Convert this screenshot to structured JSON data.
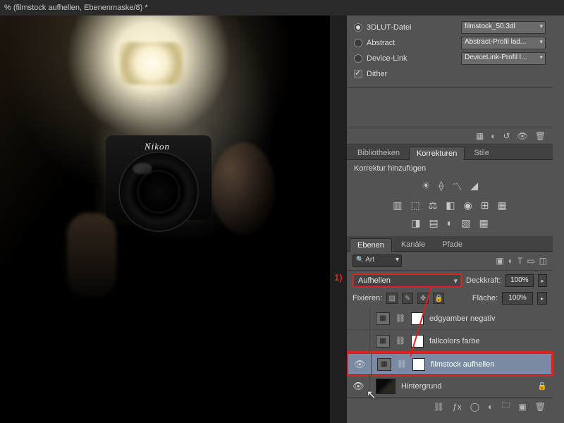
{
  "document": {
    "tab_title": "% (filmstock aufhellen, Ebenenmaske/8) *"
  },
  "camera_brand": "Nikon",
  "properties": {
    "lut_file": {
      "label": "3DLUT-Datei",
      "value": "filmstock_50.3dl"
    },
    "abstract": {
      "label": "Abstract",
      "value": "Abstract-Profil lad..."
    },
    "device": {
      "label": "Device-Link",
      "value": "DeviceLink-Profil l..."
    },
    "dither": {
      "label": "Dither"
    }
  },
  "tabs1": {
    "lib": "Bibliotheken",
    "adj": "Korrekturen",
    "styles": "Stile"
  },
  "adjustments": {
    "title": "Korrektur hinzufügen"
  },
  "tabs2": {
    "layers": "Ebenen",
    "channels": "Kanäle",
    "paths": "Pfade"
  },
  "layer_filter": {
    "kind": "Art"
  },
  "blend": {
    "mode": "Aufhellen",
    "opacity_label": "Deckkraft:",
    "opacity_value": "100%",
    "lock_label": "Fixieren:",
    "fill_label": "Fläche:",
    "fill_value": "100%"
  },
  "annotation": {
    "one": "1)"
  },
  "layers": [
    {
      "name": "edgyamber negativ",
      "visible": false,
      "adj": true
    },
    {
      "name": "fallcolors farbe",
      "visible": false,
      "adj": true
    },
    {
      "name": "filmstock aufhellen",
      "visible": true,
      "adj": true,
      "selected": true
    },
    {
      "name": "Hintergrund",
      "visible": true,
      "bg": true
    }
  ]
}
